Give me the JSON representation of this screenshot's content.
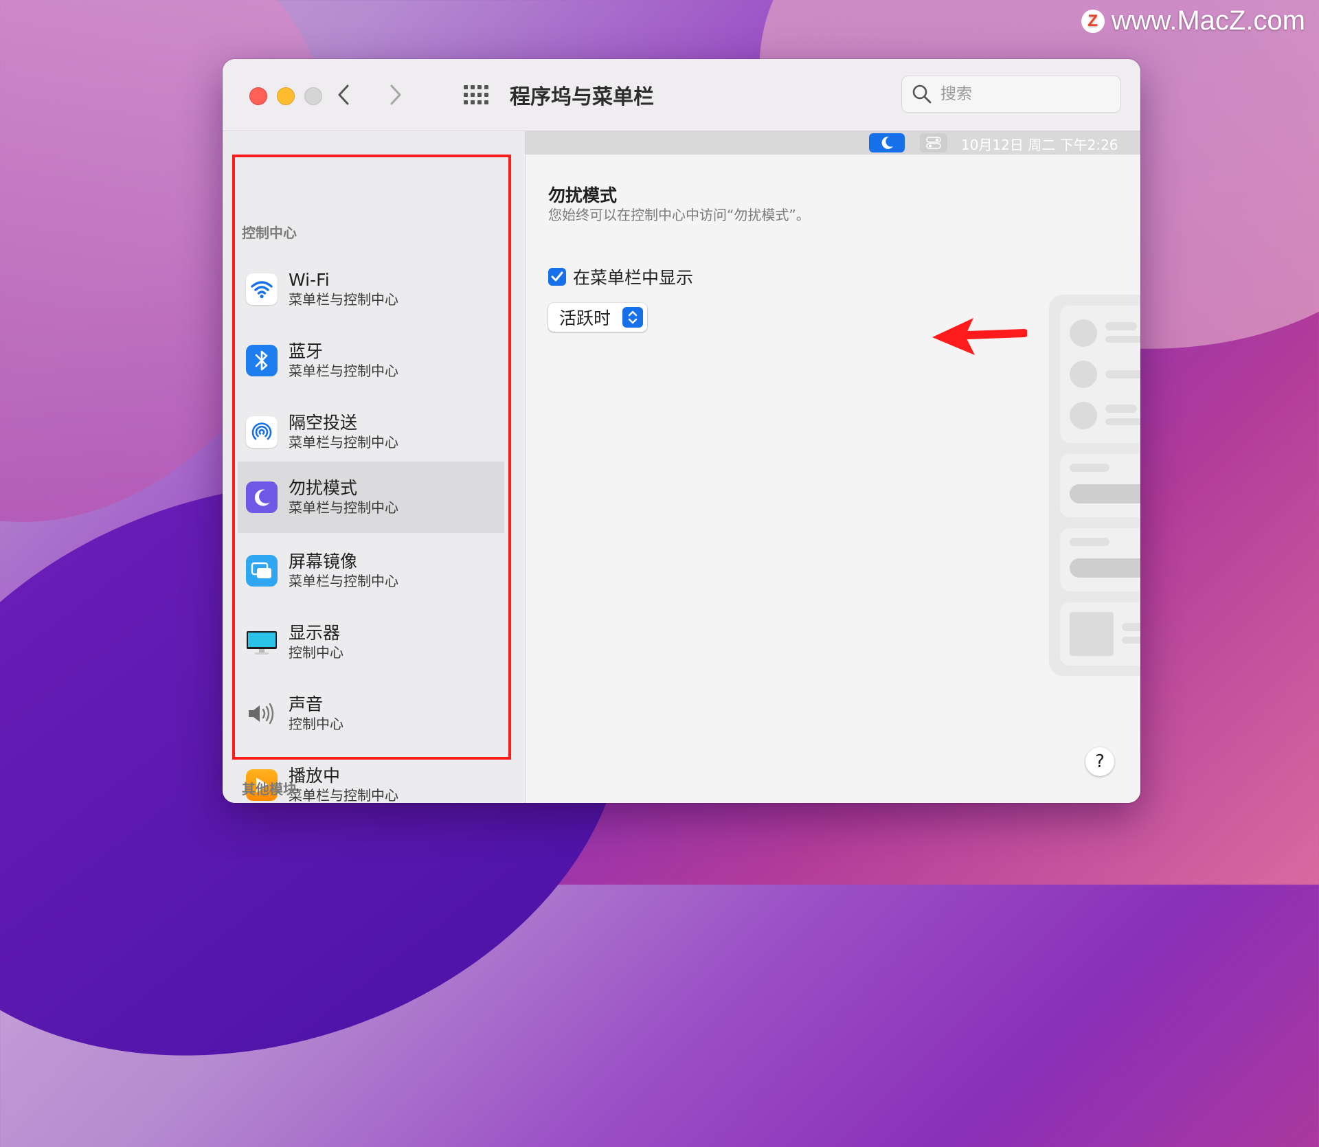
{
  "watermark": {
    "logo": "Z",
    "text": "www.MacZ.com"
  },
  "window": {
    "title": "程序坞与菜单栏"
  },
  "search": {
    "placeholder": "搜索"
  },
  "sidebar": {
    "section_control_center": "控制中心",
    "section_other": "其他模块",
    "items": [
      {
        "name": "Wi-Fi",
        "sub": "菜单栏与控制中心",
        "icon": "wifi-icon"
      },
      {
        "name": "蓝牙",
        "sub": "菜单栏与控制中心",
        "icon": "bluetooth-icon"
      },
      {
        "name": "隔空投送",
        "sub": "菜单栏与控制中心",
        "icon": "airdrop-icon"
      },
      {
        "name": "勿扰模式",
        "sub": "菜单栏与控制中心",
        "icon": "moon-icon",
        "selected": true
      },
      {
        "name": "屏幕镜像",
        "sub": "菜单栏与控制中心",
        "icon": "screen-mirroring-icon"
      },
      {
        "name": "显示器",
        "sub": "控制中心",
        "icon": "display-icon"
      },
      {
        "name": "声音",
        "sub": "控制中心",
        "icon": "speaker-icon"
      },
      {
        "name": "播放中",
        "sub": "菜单栏与控制中心",
        "icon": "now-playing-icon"
      }
    ]
  },
  "menubar": {
    "time": "10月12日 周二 下午2:26"
  },
  "detail": {
    "heading": "勿扰模式",
    "description": "您始终可以在控制中心中访问“勿扰模式”。",
    "checkbox_label": "在菜单栏中显示",
    "checkbox_checked": true,
    "select_value": "活跃时"
  },
  "help": {
    "label": "?"
  },
  "colors": {
    "accent": "#1670ea",
    "highlight_box": "#ff1b1b",
    "arrow": "#ff1b1b"
  }
}
